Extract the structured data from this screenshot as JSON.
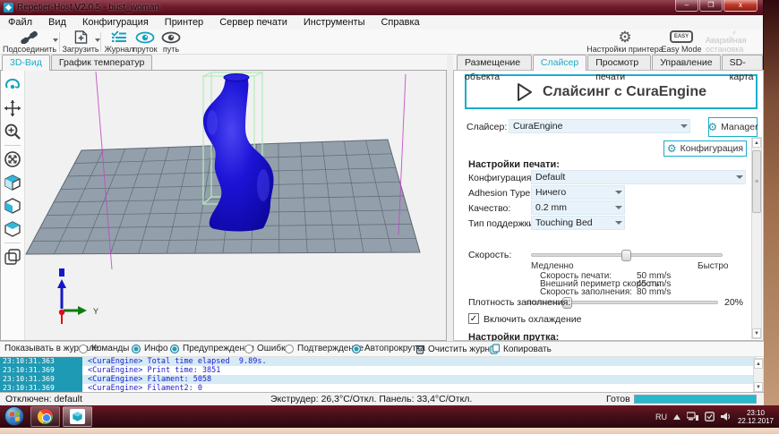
{
  "window": {
    "title": "Repetier-Host V2.0.5 - bust_woman",
    "minimize": "–",
    "maximize": "❐",
    "close": "x"
  },
  "menu": {
    "items": [
      "Файл",
      "Вид",
      "Конфигурация",
      "Принтер",
      "Сервер печати",
      "Инструменты",
      "Справка"
    ]
  },
  "toolbar": {
    "connect": "Подсоединить",
    "load": "Загрузить",
    "log": "Журнал",
    "filament": "пруток",
    "travel": "путь",
    "printer_settings": "Настройки принтера",
    "easy_mode": "Easy Mode",
    "easy_badge": "EASY",
    "emergency": "Аварийная остановка"
  },
  "left_tabs": {
    "view3d": "3D-Вид",
    "temp_graph": "График температур"
  },
  "viewport": {
    "axis_y": "Y"
  },
  "right_tabs": {
    "placement": "Размещение объекта",
    "slicer": "Слайсер",
    "preview": "Просмотр печати",
    "control": "Управление",
    "sdcard": "SD-карта"
  },
  "slicer": {
    "slice_button": "Слайсинг с CuraEngine",
    "slicer_label": "Слайсер:",
    "slicer_value": "CuraEngine",
    "manager_button": "Manager",
    "config_button": "Конфигурация",
    "print_settings_heading": "Настройки печати:",
    "rows": [
      {
        "label": "Конфигурация печати:",
        "value": "Default"
      },
      {
        "label": "Adhesion Type:",
        "value": "Ничего"
      },
      {
        "label": "Качество:",
        "value": "0.2 mm"
      },
      {
        "label": "Тип поддержки:",
        "value": "Touching Bed"
      }
    ],
    "speed_label": "Скорость:",
    "speed_slow": "Медленно",
    "speed_fast": "Быстро",
    "speed_details": [
      {
        "label": "Скорость печати:",
        "value": "50 mm/s"
      },
      {
        "label": "Внешний периметр скорость:",
        "value": "45 mm/s"
      },
      {
        "label": "Скорость заполнения:",
        "value": "80 mm/s"
      }
    ],
    "infill_label": "Плотность заполнения:",
    "infill_value": "20%",
    "cooling_label": "Включить охлаждение",
    "filament_heading": "Настройки прутка:"
  },
  "log": {
    "filter_label": "Показывать в журнале:",
    "filters": [
      {
        "label": "Команды",
        "on": false
      },
      {
        "label": "Инфо",
        "on": true
      },
      {
        "label": "Предупреждения",
        "on": true
      },
      {
        "label": "Ошибки",
        "on": false
      },
      {
        "label": "Подтверждение",
        "on": false
      },
      {
        "label": "Автопрокрутка",
        "on": true
      }
    ],
    "clear_button": "Очистить журнал",
    "copy_button": "Копировать",
    "entries": [
      {
        "time": "23:10:31.363",
        "text": "<CuraEngine> Total time elapsed  9.89s."
      },
      {
        "time": "23:10:31.369",
        "text": "<CuraEngine> Print time: 3851"
      },
      {
        "time": "23:10:31.369",
        "text": "<CuraEngine> Filament: 5058"
      },
      {
        "time": "23:10:31.369",
        "text": "<CuraEngine> Filament2: 0"
      }
    ]
  },
  "statusbar": {
    "connection": "Отключен: default",
    "temps": "Экструдер: 26,3°C/Откл. Панель: 33,4°C/Откл.",
    "ready": "Готов"
  },
  "taskbar": {
    "lang": "RU",
    "time": "23:10",
    "date": "22.12.2017"
  },
  "colors": {
    "accent": "#19aecb",
    "log_ts_bg": "#1f9ab5",
    "log_text": "#1a1acd",
    "model_blue": "#1c13d6",
    "bed_fill": "#93a0ac",
    "volume_green": "#b2ecba",
    "frame_magenta": "#c04ac4",
    "ready_bar": "#28b7cd"
  }
}
